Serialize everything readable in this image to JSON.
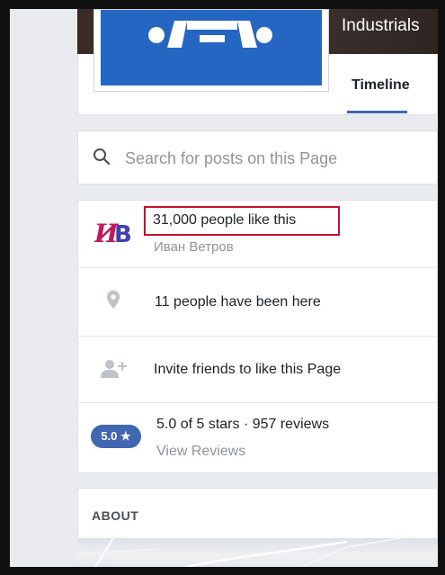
{
  "header": {
    "cover_title": "Industrials",
    "tab_timeline": "Timeline"
  },
  "search": {
    "placeholder": "Search for posts on this Page"
  },
  "info": {
    "likes_text": "31,000 people like this",
    "liker_name": "Иван Ветров",
    "liker_initials": "ИВ",
    "checkins_text": "11 people have been here",
    "invite_text": "Invite friends to like this Page",
    "rating_badge": "5.0 ★",
    "rating_text": "5.0 of 5 stars · 957 reviews",
    "view_reviews": "View Reviews"
  },
  "about": {
    "title": "ABOUT"
  },
  "colors": {
    "accent": "#4267b2",
    "highlight": "#c8102e",
    "profile_blue": "#2466c2"
  },
  "icons": {
    "search": "search-icon",
    "location": "location-pin-icon",
    "invite": "add-friend-icon"
  }
}
